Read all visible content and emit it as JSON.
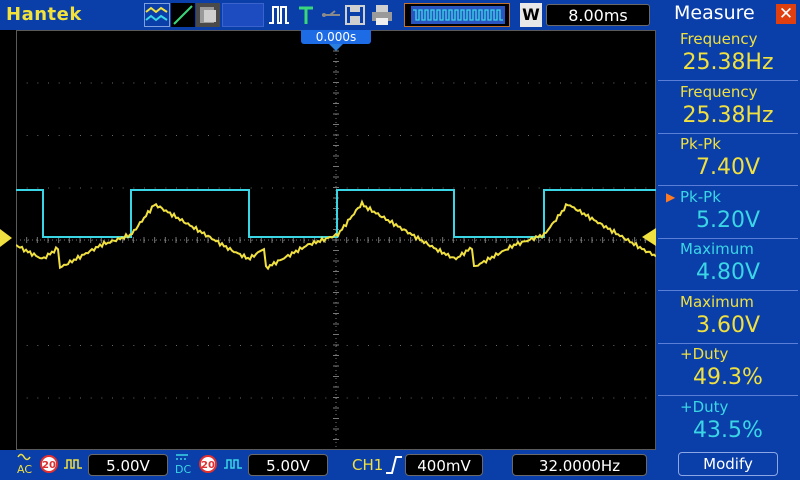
{
  "brand": "Hantek",
  "trigger_time": "0.000s",
  "timebase": "8.00ms",
  "measure": {
    "title": "Measure",
    "items": [
      {
        "label": "Frequency",
        "value": "25.38Hz",
        "color": "#f0e040"
      },
      {
        "label": "Frequency",
        "value": "25.38Hz",
        "color": "#f0e040"
      },
      {
        "label": "Pk-Pk",
        "value": "7.40V",
        "color": "#f0e040"
      },
      {
        "label": "Pk-Pk",
        "value": "5.20V",
        "color": "#3ad6e6"
      },
      {
        "label": "Maximum",
        "value": "4.80V",
        "color": "#3ad6e6"
      },
      {
        "label": "Maximum",
        "value": "3.60V",
        "color": "#f0e040"
      },
      {
        "label": "+Duty",
        "value": "49.3%",
        "color": "#f0e040"
      },
      {
        "label": "+Duty",
        "value": "43.5%",
        "color": "#3ad6e6"
      }
    ],
    "modify_label": "Modify"
  },
  "channels": {
    "ch1": {
      "coupling": "AC",
      "bw": "20",
      "volts": "5.00V",
      "color": "#f0e040"
    },
    "ch2": {
      "coupling": "DC",
      "bw": "20",
      "volts": "5.00V",
      "color": "#3ad6e6"
    }
  },
  "trigger": {
    "source": "CH1",
    "level": "400mV"
  },
  "frequency_counter": "32.0000Hz",
  "colors": {
    "bar": "#0a3ea8",
    "ch1": "#f0e040",
    "ch2": "#3ad6e6",
    "grid": "#5a5a5a"
  }
}
